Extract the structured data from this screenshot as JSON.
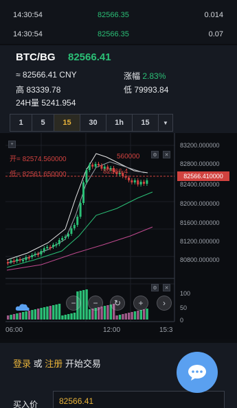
{
  "trades": [
    {
      "time": "14:30:54",
      "price": "82566.35",
      "amount": "0.014"
    },
    {
      "time": "14:30:54",
      "price": "82566.35",
      "amount": "0.07"
    }
  ],
  "ticker": {
    "pair": "BTC/BG",
    "price": "82566.41",
    "cny": "≈ 82566.41 CNY",
    "change_label": "涨幅",
    "change_value": "2.83%",
    "high": "高 83339.78",
    "low": "低 79993.84",
    "volume": "24H量 5241.954"
  },
  "tabs": [
    "1",
    "5",
    "15",
    "30",
    "1h",
    "15"
  ],
  "tab_active_index": 2,
  "chart": {
    "y_labels": [
      "83200.000000",
      "82800.000000",
      "82400.000000",
      "82000.000000",
      "81600.000000",
      "81200.000000",
      "80800.000000"
    ],
    "current_price": "82566.410000",
    "open_label": "开= 82574.560000",
    "low_label": "低= 82561.650000",
    "mid_label_1": "560000",
    "mid_label_2": "82566.4",
    "vol_labels": [
      "100",
      "50",
      "0"
    ],
    "x_labels": [
      "06:00",
      "12:00",
      "15:3"
    ]
  },
  "colors": {
    "up": "#2bbf76",
    "down": "#d1423f",
    "accent": "#e8b33a"
  },
  "bottom": {
    "login": "登录",
    "or": "或",
    "register": "注册",
    "start": "开始交易",
    "buy_label": "买入价",
    "buy_value": "82566.41"
  },
  "icons": {
    "chat": "chat-bubble-icon",
    "dropdown": "caret-down-icon",
    "fullscreen": "crosshair-icon"
  }
}
